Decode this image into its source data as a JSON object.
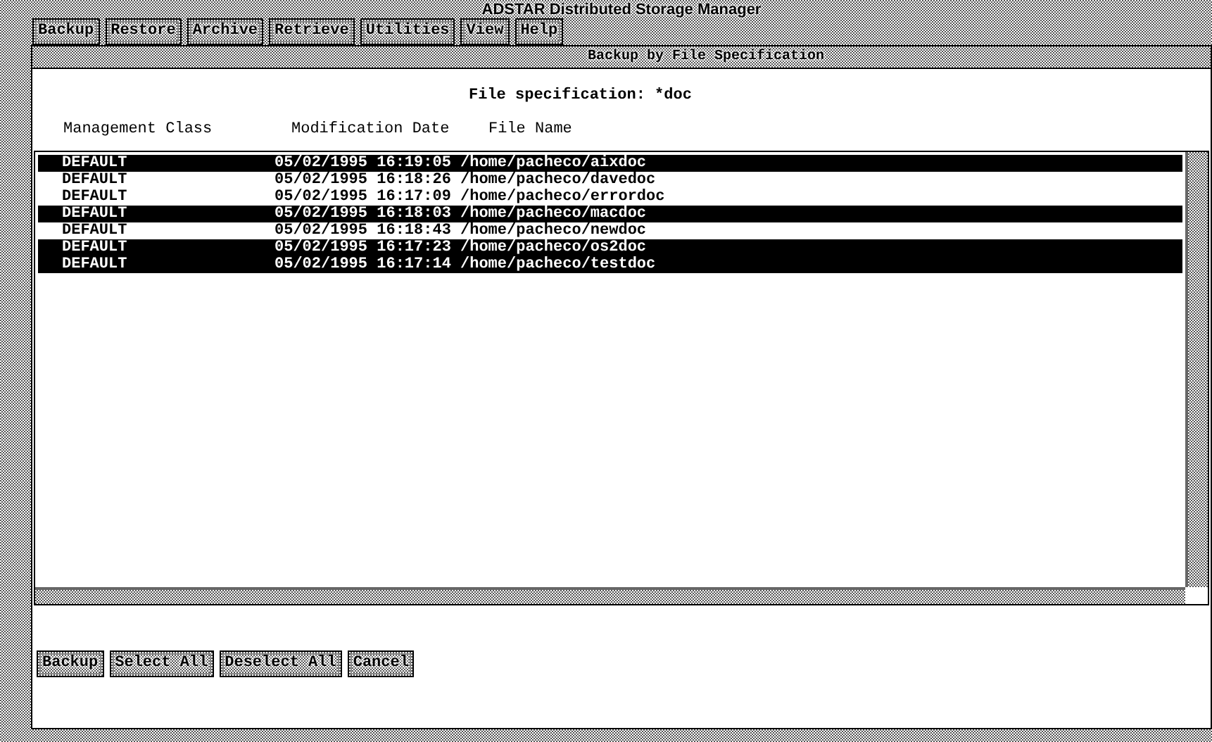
{
  "window": {
    "title": "ADSTAR Distributed Storage Manager"
  },
  "menu": [
    "Backup",
    "Restore",
    "Archive",
    "Retrieve",
    "Utilities",
    "View",
    "Help"
  ],
  "panel": {
    "title": "Backup by File Specification",
    "file_specification": "File specification: *doc"
  },
  "table": {
    "columns": [
      "Management Class",
      "Modification Date",
      "File Name"
    ],
    "rows": [
      {
        "management_class": "DEFAULT",
        "modification_date": "05/02/1995 16:19:05",
        "file_name": "/home/pacheco/aixdoc",
        "selected": true
      },
      {
        "management_class": "DEFAULT",
        "modification_date": "05/02/1995 16:18:26",
        "file_name": "/home/pacheco/davedoc",
        "selected": false
      },
      {
        "management_class": "DEFAULT",
        "modification_date": "05/02/1995 16:17:09",
        "file_name": "/home/pacheco/errordoc",
        "selected": false
      },
      {
        "management_class": "DEFAULT",
        "modification_date": "05/02/1995 16:18:03",
        "file_name": "/home/pacheco/macdoc",
        "selected": true
      },
      {
        "management_class": "DEFAULT",
        "modification_date": "05/02/1995 16:18:43",
        "file_name": "/home/pacheco/newdoc",
        "selected": false
      },
      {
        "management_class": "DEFAULT",
        "modification_date": "05/02/1995 16:17:23",
        "file_name": "/home/pacheco/os2doc",
        "selected": true
      },
      {
        "management_class": "DEFAULT",
        "modification_date": "05/02/1995 16:17:14",
        "file_name": "/home/pacheco/testdoc",
        "selected": true
      }
    ]
  },
  "buttons": [
    "Backup",
    "Select All",
    "Deselect All",
    "Cancel"
  ]
}
